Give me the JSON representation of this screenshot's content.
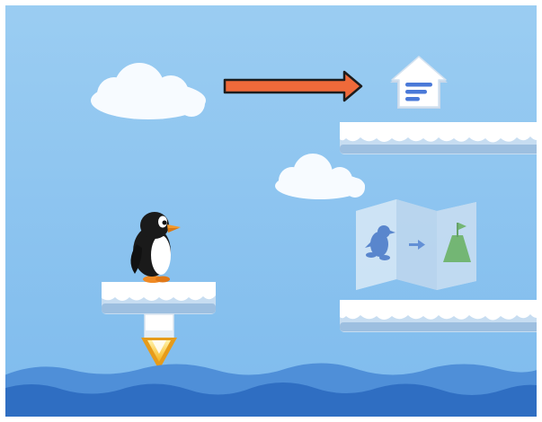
{
  "scene": {
    "sky_top": "#9bcdf2",
    "sky_bottom": "#7ebbed",
    "water_light": "#4f8fd8",
    "water_dark": "#2f6ec2",
    "cloud": "#f7fbff",
    "ice_top": "#ffffff",
    "ice_base": "#c7ddf1",
    "ice_shadow": "#9dbfe0",
    "arrow": "#ef6a3a",
    "arrow_outline": "#1d1d1d"
  },
  "sprites": {
    "player": "penguin-icon",
    "goal": "house-icon",
    "hint": "map-icon",
    "booster": "rocket-thruster-icon",
    "direction": "arrow-right-icon"
  },
  "hint_map": {
    "from": "penguin-silhouette-icon",
    "arrow": "arrow-right-icon",
    "to": "mountain-icon"
  }
}
